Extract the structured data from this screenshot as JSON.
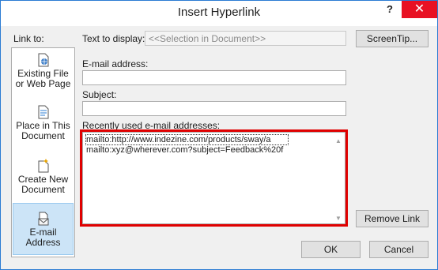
{
  "window": {
    "title": "Insert Hyperlink",
    "help_label": "?",
    "close_label": "✕"
  },
  "link_to": {
    "label": "Link to:",
    "items": [
      {
        "label_1": "Existing File",
        "label_2": "or Web Page",
        "icon": "globe-file-icon"
      },
      {
        "label_1": "Place in This",
        "label_2": "Document",
        "icon": "document-icon"
      },
      {
        "label_1": "Create New",
        "label_2": "Document",
        "icon": "new-document-icon"
      },
      {
        "label_1": "E-mail",
        "label_2": "Address",
        "icon": "envelope-icon"
      }
    ],
    "selected": "E-mail Address"
  },
  "text_to_display": {
    "label": "Text to display:",
    "value": "<<Selection in Document>>"
  },
  "screentip_button": "ScreenTip...",
  "email_address": {
    "label": "E-mail address:",
    "value": ""
  },
  "subject": {
    "label": "Subject:",
    "value": ""
  },
  "recent": {
    "label": "Recently used e-mail addresses:",
    "items": [
      "mailto:http://www.indezine.com/products/sway/a",
      "mailto:xyz@wherever.com?subject=Feedback%20f"
    ]
  },
  "remove_link_button": "Remove Link",
  "ok_button": "OK",
  "cancel_button": "Cancel",
  "colors": {
    "highlight": "#e00000",
    "accent": "#2b7cd3",
    "selection": "#cce4f7"
  }
}
